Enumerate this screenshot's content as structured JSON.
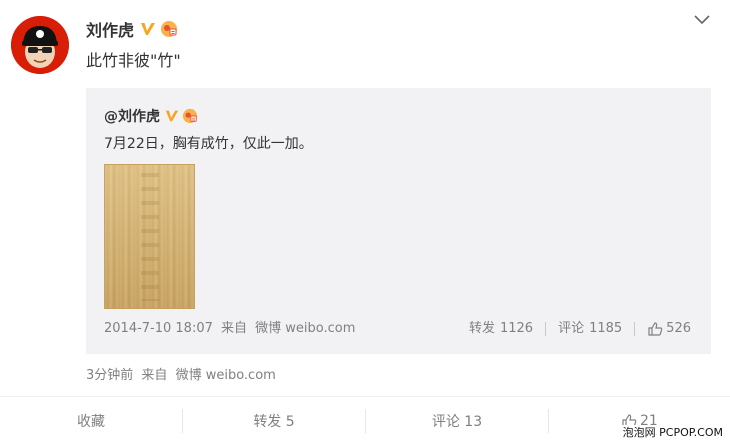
{
  "post": {
    "author": "刘作虎",
    "text": "此竹非彼\"竹\"",
    "time": "3分钟前",
    "source_prefix": "来自",
    "source": "微博 weibo.com"
  },
  "repost": {
    "author": "@刘作虎",
    "text": "7月22日，胸有成竹，仅此一加。",
    "date": "2014-7-10 18:07",
    "source_prefix": "来自",
    "source": "微博 weibo.com",
    "repost_label": "转发",
    "repost_count": "1126",
    "comment_label": "评论",
    "comment_count": "1185",
    "like_count": "526"
  },
  "footer": {
    "favorite_label": "收藏",
    "repost_label": "转发 5",
    "comment_label": "评论 13",
    "like_count": "21"
  },
  "watermark": "泡泡网 PCPOP.COM",
  "colors": {
    "text": "#333333",
    "meta": "#808080",
    "repost_bg": "#f2f2f5",
    "verified": "#f6a623",
    "avatar_bg": "#d81e06"
  },
  "icons": [
    "verified-v-icon",
    "club-badge-icon",
    "chevron-down-icon",
    "thumbs-up-icon"
  ]
}
